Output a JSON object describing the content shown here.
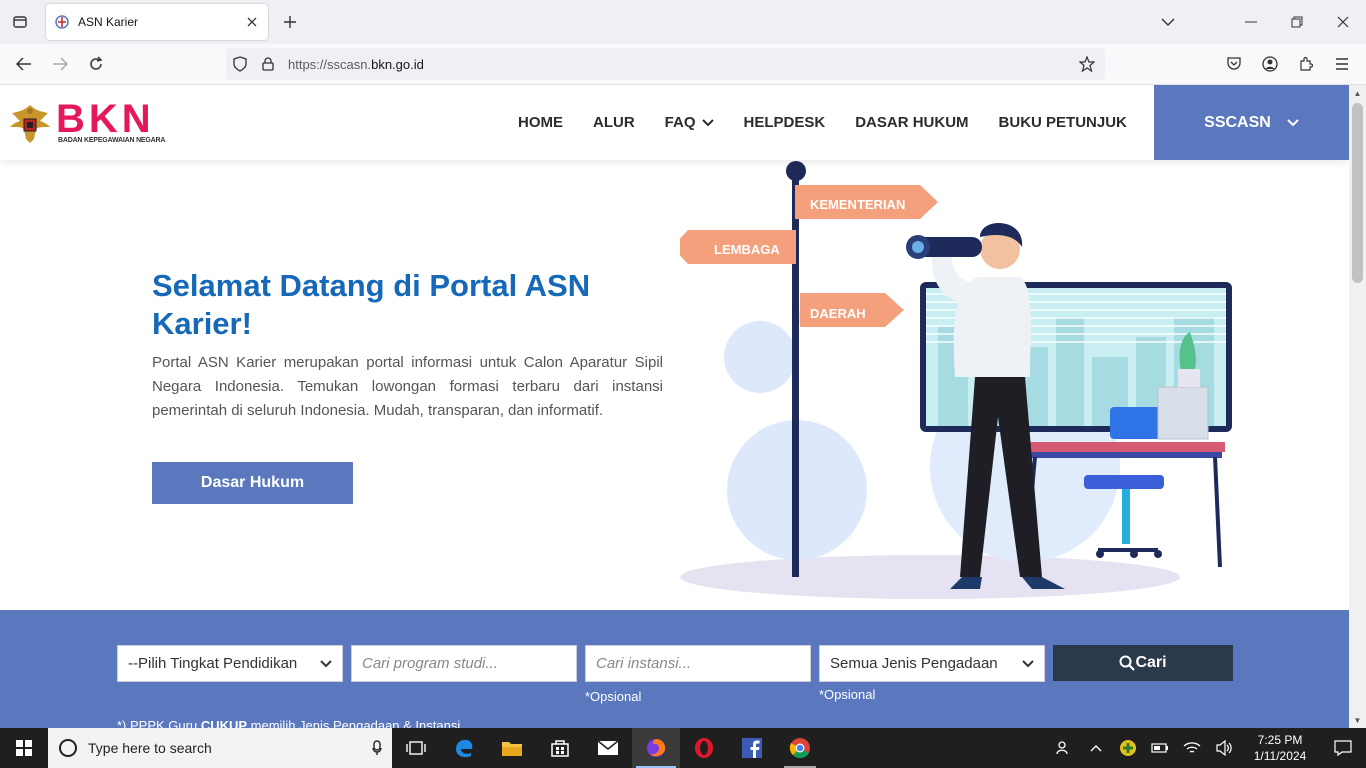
{
  "browser": {
    "tab_title": "ASN Karier",
    "url_prefix": "https://sscasn.",
    "url_domain": "bkn.go.id"
  },
  "site": {
    "logo_text": "BKN",
    "logo_subtitle": "BADAN KEPEGAWAIAN NEGARA",
    "menu": [
      "HOME",
      "ALUR",
      "FAQ",
      "HELPDESK",
      "DASAR HUKUM",
      "BUKU PETUNJUK"
    ],
    "sscasn_label": "SSCASN"
  },
  "hero": {
    "title": "Selamat Datang di Portal ASN Karier!",
    "description": "Portal ASN Karier merupakan portal informasi untuk Calon Aparatur Sipil Negara Indonesia. Temukan lowongan formasi terbaru dari instansi pemerintah di seluruh Indonesia. Mudah, transparan, dan informatif.",
    "button": "Dasar Hukum",
    "signs": [
      "KEMENTERIAN",
      "LEMBAGA",
      "DAERAH"
    ]
  },
  "search": {
    "education_select": "--Pilih Tingkat Pendidikan",
    "program_placeholder": "Cari program studi...",
    "instansi_placeholder": "Cari instansi...",
    "jenis_select": "Semua Jenis Pengadaan",
    "opsional_label": "*Opsional",
    "cari_button": "Cari",
    "note_prefix": "*) PPPK Guru ",
    "note_bold": "CUKUP",
    "note_suffix": " memilih Jenis Pengadaan & Instansi"
  },
  "taskbar": {
    "search_placeholder": "Type here to search",
    "time": "7:25 PM",
    "date": "1/11/2024"
  }
}
